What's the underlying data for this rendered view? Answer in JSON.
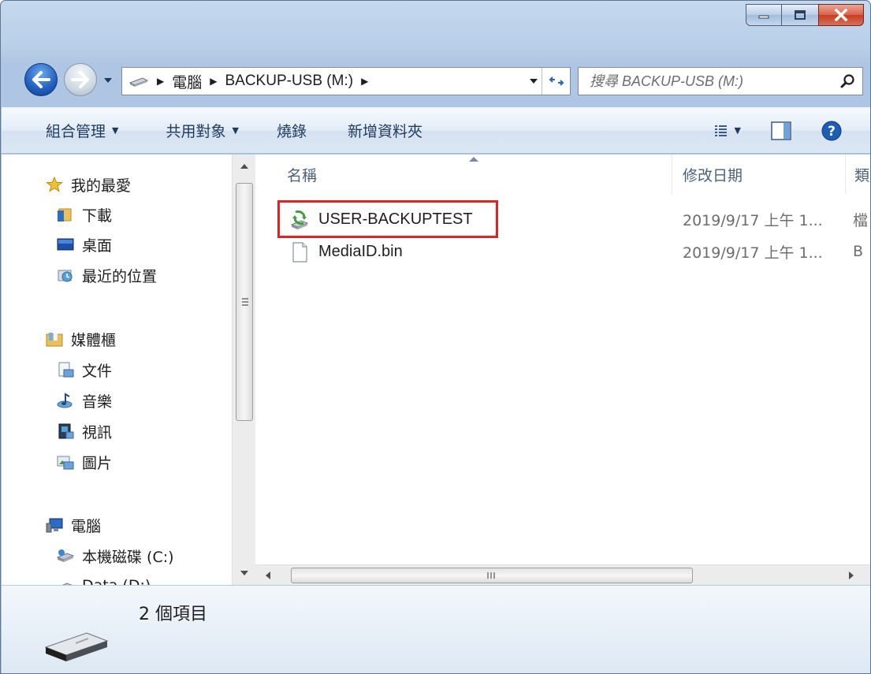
{
  "window": {
    "accent_colors": {
      "title_gradient": "#b9cfe8",
      "close_button": "#c63e21",
      "highlight_box": "#e02424"
    }
  },
  "address": {
    "breadcrumbs": [
      "電腦",
      "BACKUP-USB (M:)"
    ]
  },
  "search": {
    "placeholder": "搜尋 BACKUP-USB (M:)"
  },
  "toolbar": {
    "organize": "組合管理",
    "share": "共用對象",
    "burn": "燒錄",
    "new_folder": "新增資料夾"
  },
  "nav_pane": {
    "favorites": {
      "label": "我的最愛",
      "icon": "star-icon"
    },
    "favorites_items": [
      {
        "label": "下載",
        "icon": "downloads-folder-icon"
      },
      {
        "label": "桌面",
        "icon": "desktop-icon"
      },
      {
        "label": "最近的位置",
        "icon": "recent-places-icon"
      }
    ],
    "libraries": {
      "label": "媒體櫃",
      "icon": "library-icon"
    },
    "libraries_items": [
      {
        "label": "文件",
        "icon": "documents-icon"
      },
      {
        "label": "音樂",
        "icon": "music-icon"
      },
      {
        "label": "視訊",
        "icon": "video-icon"
      },
      {
        "label": "圖片",
        "icon": "pictures-icon"
      }
    ],
    "computer": {
      "label": "電腦",
      "icon": "computer-icon"
    },
    "computer_items": [
      {
        "label": "本機磁碟 (C:)",
        "icon": "local-disk-icon"
      },
      {
        "label": "Data (D:)",
        "icon": "drive-icon"
      }
    ]
  },
  "file_list": {
    "columns": {
      "name": "名稱",
      "date_modified": "修改日期",
      "type": "類"
    },
    "rows": [
      {
        "name": "USER-BACKUPTEST",
        "date": "2019/9/17 上午 1...",
        "type": "檔",
        "icon": "backup-set-icon",
        "highlighted": true
      },
      {
        "name": "MediaID.bin",
        "date": "2019/9/17 上午 1...",
        "type": "B",
        "icon": "file-icon",
        "highlighted": false
      }
    ]
  },
  "status": {
    "item_count": "2 個項目"
  }
}
